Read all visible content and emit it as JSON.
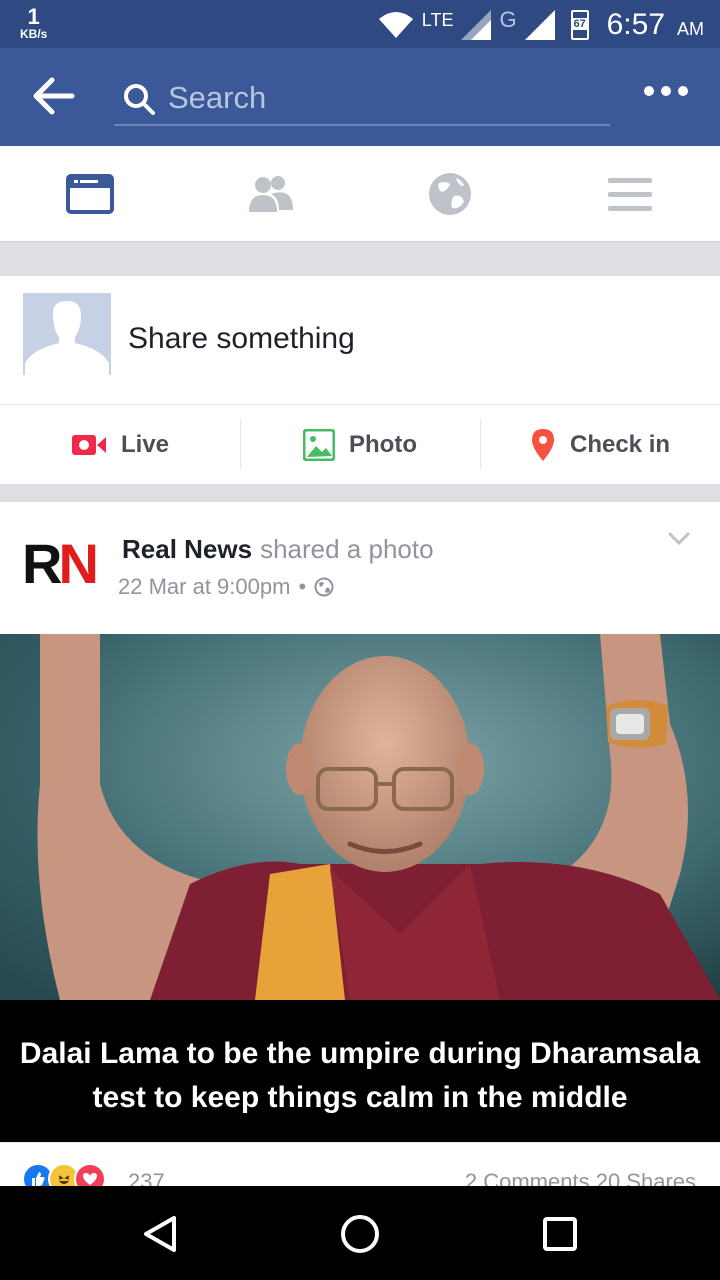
{
  "status_bar": {
    "speed_value": "1",
    "speed_unit": "KB/s",
    "network_lte": "LTE",
    "network_g": "G",
    "battery": "67",
    "time": "6:57",
    "ampm": "AM"
  },
  "app_bar": {
    "search_placeholder": "Search"
  },
  "tabs": [
    {
      "icon": "news-feed-icon",
      "active": true
    },
    {
      "icon": "friends-icon",
      "active": false
    },
    {
      "icon": "globe-icon",
      "active": false
    },
    {
      "icon": "menu-icon",
      "active": false
    }
  ],
  "composer": {
    "prompt": "Share something",
    "actions": [
      {
        "label": "Live",
        "icon": "live-video-icon",
        "color": "#f02849"
      },
      {
        "label": "Photo",
        "icon": "photo-icon",
        "color": "#45bd62"
      },
      {
        "label": "Check in",
        "icon": "location-pin-icon",
        "color": "#f5533d"
      }
    ]
  },
  "post": {
    "page_logo": "RN",
    "author": "Real News",
    "action": "shared a photo",
    "timestamp": "22 Mar at 9:00pm",
    "separator": "•",
    "privacy_icon": "globe-icon",
    "caption_line1": "Dalai Lama to be the umpire during Dharamsala",
    "caption_line2": "test to keep things calm in the middle",
    "reactions_count": "237",
    "comments": "2 Comments",
    "shares": "20 Shares"
  },
  "colors": {
    "brand": "#3b5998",
    "status_bar": "#2f4a82",
    "accent_red": "#e21b1b"
  }
}
